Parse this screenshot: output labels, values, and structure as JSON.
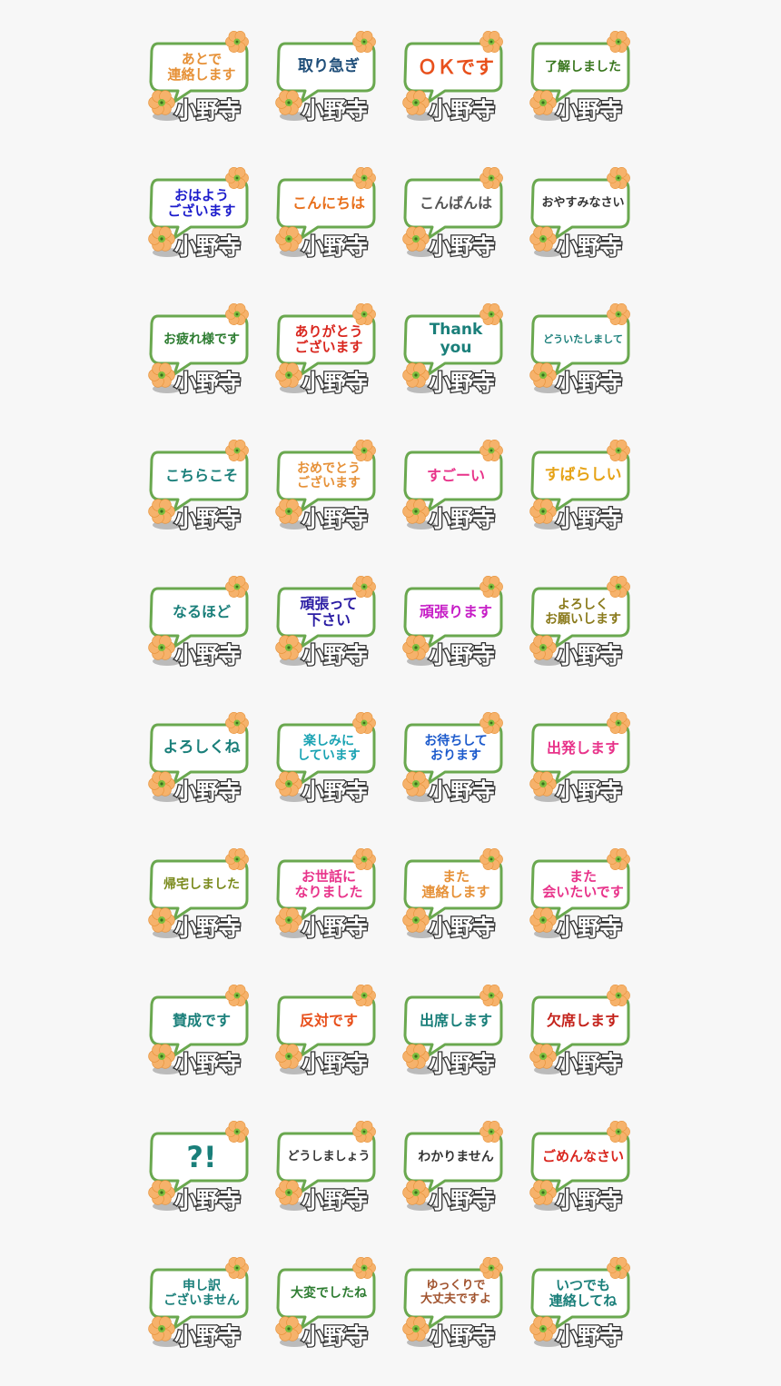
{
  "name_label": "小野寺",
  "colors": {
    "bubble_border": "#6aa84f",
    "flower": "#f6b26b",
    "flower_center": "#7fbf3f",
    "name_stroke": "#333333"
  },
  "stickers": [
    {
      "lines": [
        "あとで",
        "連絡します"
      ],
      "color": "#e69138",
      "size": 15
    },
    {
      "lines": [
        "取り急ぎ"
      ],
      "color": "#1f4e79",
      "size": 17
    },
    {
      "lines": [
        "ＯＫです"
      ],
      "color": "#e8501c",
      "size": 21
    },
    {
      "lines": [
        "了解しました"
      ],
      "color": "#38761d",
      "size": 14
    },
    {
      "lines": [
        "おはよう",
        "ございます"
      ],
      "color": "#1c1ccc",
      "size": 15
    },
    {
      "lines": [
        "こんにちは"
      ],
      "color": "#e8701c",
      "size": 16
    },
    {
      "lines": [
        "こんばんは"
      ],
      "color": "#555555",
      "size": 16
    },
    {
      "lines": [
        "おやすみなさい"
      ],
      "color": "#333333",
      "size": 13
    },
    {
      "lines": [
        "お疲れ様です"
      ],
      "color": "#2e7d32",
      "size": 14
    },
    {
      "lines": [
        "ありがとう",
        "ございます"
      ],
      "color": "#d9251d",
      "size": 15
    },
    {
      "lines": [
        "Thank",
        "you"
      ],
      "color": "#1a7f7a",
      "size": 17
    },
    {
      "lines": [
        "どういたしまして"
      ],
      "color": "#1a7f7a",
      "size": 11
    },
    {
      "lines": [
        "こちらこそ"
      ],
      "color": "#1a7f7a",
      "size": 16
    },
    {
      "lines": [
        "おめでとう",
        "ございます"
      ],
      "color": "#e69138",
      "size": 14
    },
    {
      "lines": [
        "すごーい"
      ],
      "color": "#e8338a",
      "size": 16
    },
    {
      "lines": [
        "すばらしい"
      ],
      "color": "#e6a317",
      "size": 17
    },
    {
      "lines": [
        "なるほど"
      ],
      "color": "#1a7f7a",
      "size": 16
    },
    {
      "lines": [
        "頑張って",
        "下さい"
      ],
      "color": "#2a1ca3",
      "size": 16
    },
    {
      "lines": [
        "頑張ります"
      ],
      "color": "#c61cc6",
      "size": 16
    },
    {
      "lines": [
        "よろしく",
        "お願いします"
      ],
      "color": "#8a7a1c",
      "size": 14
    },
    {
      "lines": [
        "よろしくね"
      ],
      "color": "#1a7f7a",
      "size": 17
    },
    {
      "lines": [
        "楽しみに",
        "しています"
      ],
      "color": "#1aa3b3",
      "size": 14
    },
    {
      "lines": [
        "お待ちして",
        "おります"
      ],
      "color": "#1c5acc",
      "size": 14
    },
    {
      "lines": [
        "出発します"
      ],
      "color": "#e8338a",
      "size": 16
    },
    {
      "lines": [
        "帰宅しました"
      ],
      "color": "#7a8a1c",
      "size": 14
    },
    {
      "lines": [
        "お世話に",
        "なりました"
      ],
      "color": "#e8338a",
      "size": 15
    },
    {
      "lines": [
        "また",
        "連絡します"
      ],
      "color": "#e69138",
      "size": 15
    },
    {
      "lines": [
        "また",
        "会いたいです"
      ],
      "color": "#e8338a",
      "size": 15
    },
    {
      "lines": [
        "賛成です"
      ],
      "color": "#1a7f7a",
      "size": 16
    },
    {
      "lines": [
        "反対です"
      ],
      "color": "#e8501c",
      "size": 16
    },
    {
      "lines": [
        "出席します"
      ],
      "color": "#1a7f7a",
      "size": 16
    },
    {
      "lines": [
        "欠席します"
      ],
      "color": "#c4231c",
      "size": 16
    },
    {
      "lines": [
        "?!"
      ],
      "color": "#1a7f7a",
      "size": 32
    },
    {
      "lines": [
        "どうしましょう"
      ],
      "color": "#333333",
      "size": 13
    },
    {
      "lines": [
        "わかりません"
      ],
      "color": "#333333",
      "size": 14
    },
    {
      "lines": [
        "ごめんなさい"
      ],
      "color": "#d9251d",
      "size": 15
    },
    {
      "lines": [
        "申し訳",
        "ございません"
      ],
      "color": "#1a7f7a",
      "size": 14
    },
    {
      "lines": [
        "大変でしたね"
      ],
      "color": "#2e7d32",
      "size": 14
    },
    {
      "lines": [
        "ゆっくりで",
        "大丈夫ですよ"
      ],
      "color": "#a0522d",
      "size": 13
    },
    {
      "lines": [
        "いつでも",
        "連絡してね"
      ],
      "color": "#1a7f7a",
      "size": 15
    }
  ]
}
